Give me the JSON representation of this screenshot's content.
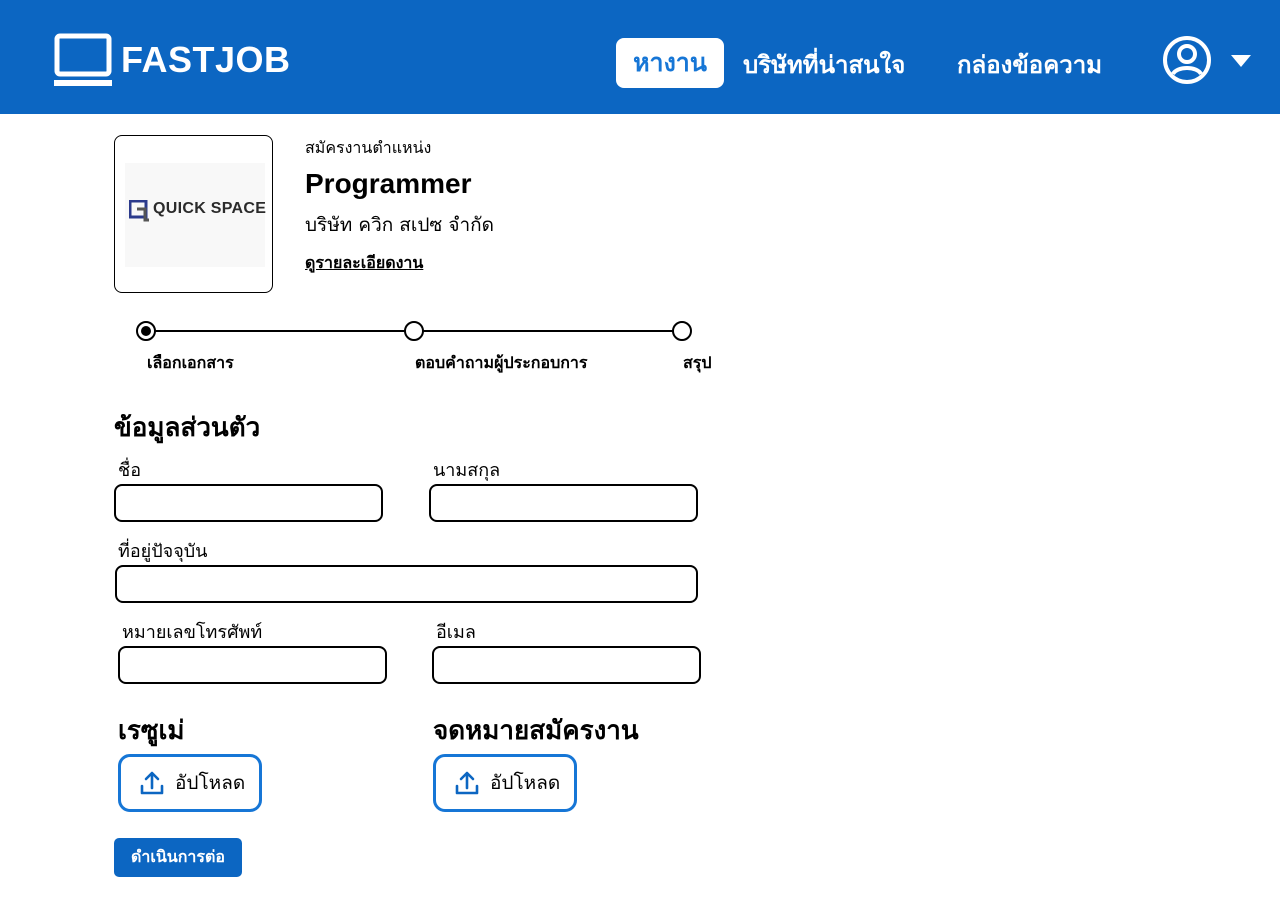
{
  "header": {
    "brand": "FASTJOB",
    "nav": {
      "find_jobs": "หางาน",
      "interesting_companies": "บริษัทที่น่าสนใจ",
      "inbox": "กล่องข้อความ"
    },
    "colors": {
      "bar": "#0c66c2",
      "active_text": "#1676d6"
    },
    "icons": {
      "brand": "laptop-icon",
      "profile": "user-circle-icon",
      "menu": "caret-down-icon"
    }
  },
  "job": {
    "apply_label": "สมัครงานตำแหน่ง",
    "title": "Programmer",
    "company": "บริษัท ควิก สเปซ จำกัด",
    "details_link": "ดูรายละเอียดงาน",
    "company_logo_text": "QUICK SPACE"
  },
  "stepper": {
    "steps": [
      "เลือกเอกสาร",
      "ตอบคำถามผู้ประกอบการ",
      "สรุป"
    ],
    "current": 0
  },
  "form": {
    "personal_title": "ข้อมูลส่วนตัว",
    "first_name": {
      "label": "ชื่อ",
      "value": ""
    },
    "last_name": {
      "label": "นามสกุล",
      "value": ""
    },
    "address": {
      "label": "ที่อยู่ปัจจุบัน",
      "value": ""
    },
    "phone": {
      "label": "หมายเลขโทรศัพท์",
      "value": ""
    },
    "email": {
      "label": "อีเมล",
      "value": ""
    }
  },
  "uploads": {
    "resume_title": "เรซูเม่",
    "cover_title": "จดหมายสมัครงาน",
    "upload_label": "อัปโหลด",
    "icon": "upload-icon"
  },
  "actions": {
    "continue": "ดำเนินการต่อ"
  }
}
